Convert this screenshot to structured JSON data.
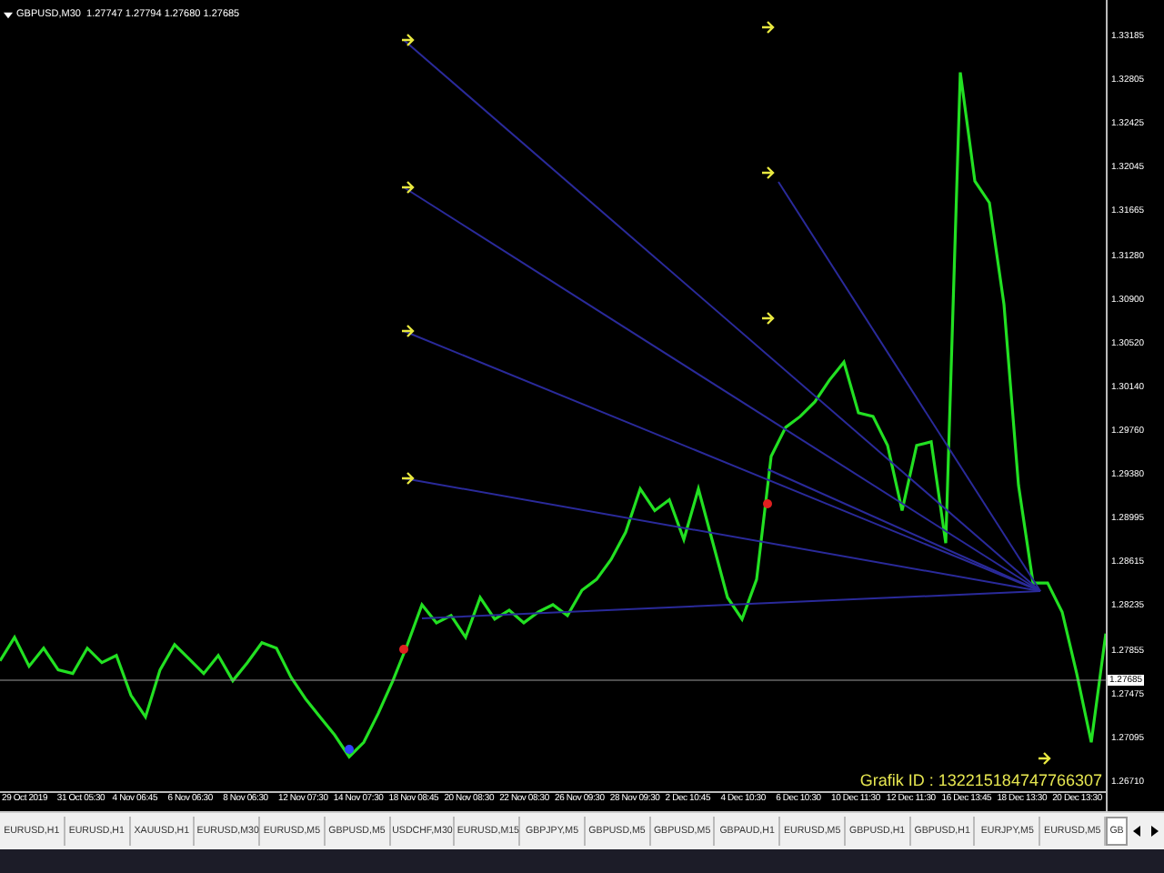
{
  "chart": {
    "title": "GBPUSD,M30  1.27747 1.27794 1.27680 1.27685",
    "info_label": "Grafik ID : 132215184747766307",
    "current_price": "1.27685",
    "time_labels": [
      "29 Oct 2019",
      "31 Oct 05:30",
      "4 Nov 06:45",
      "6 Nov 06:30",
      "8 Nov 06:30",
      "12 Nov 07:30",
      "14 Nov 07:30",
      "18 Nov 08:45",
      "20 Nov 08:30",
      "22 Nov 08:30",
      "26 Nov 09:30",
      "28 Nov 09:30",
      "2 Dec 10:45",
      "4 Dec 10:30",
      "6 Dec 10:30",
      "10 Dec 11:30",
      "12 Dec 11:30",
      "16 Dec 13:45",
      "18 Dec 13:30",
      "20 Dec 13:30"
    ],
    "chart_data": {
      "type": "line",
      "ylim": [
        1.266,
        1.335
      ],
      "yticks": [
        {
          "value": 1.33185,
          "label": "1.33185"
        },
        {
          "value": 1.32805,
          "label": "1.32805"
        },
        {
          "value": 1.32425,
          "label": "1.32425"
        },
        {
          "value": 1.32045,
          "label": "1.32045"
        },
        {
          "value": 1.31665,
          "label": "1.31665"
        },
        {
          "value": 1.3128,
          "label": "1.31280"
        },
        {
          "value": 1.309,
          "label": "1.30900"
        },
        {
          "value": 1.3052,
          "label": "1.30520"
        },
        {
          "value": 1.3014,
          "label": "1.30140"
        },
        {
          "value": 1.2976,
          "label": "1.29760"
        },
        {
          "value": 1.2938,
          "label": "1.29380"
        },
        {
          "value": 1.28995,
          "label": "1.28995"
        },
        {
          "value": 1.28615,
          "label": "1.28615"
        },
        {
          "value": 1.28235,
          "label": "1.28235"
        },
        {
          "value": 1.27855,
          "label": "1.27855"
        },
        {
          "value": 1.27475,
          "label": "1.27475"
        },
        {
          "value": 1.27095,
          "label": "1.27095"
        },
        {
          "value": 1.2671,
          "label": "1.26710"
        }
      ],
      "series": [
        {
          "color": "#22e022",
          "values": [
            1.27737,
            1.27942,
            1.2769,
            1.27848,
            1.27658,
            1.27626,
            1.27848,
            1.27721,
            1.27784,
            1.27437,
            1.27248,
            1.27658,
            1.27879,
            1.27753,
            1.27626,
            1.27784,
            1.27563,
            1.27721,
            1.27895,
            1.27848,
            1.27595,
            1.27405,
            1.27248,
            1.2709,
            1.269,
            1.27027,
            1.27279,
            1.27563,
            1.27879,
            1.28226,
            1.28069,
            1.28132,
            1.27942,
            1.2829,
            1.281,
            1.28179,
            1.28069,
            1.28163,
            1.28226,
            1.28132,
            1.28353,
            1.28448,
            1.28621,
            1.28858,
            1.29237,
            1.29048,
            1.29142,
            1.28795,
            1.29237,
            1.28763,
            1.2829,
            1.281,
            1.28448,
            1.29521,
            1.29774,
            1.29869,
            1.29995,
            1.30184,
            1.30342,
            1.299,
            1.29869,
            1.29616,
            1.29048,
            1.29616,
            1.29647,
            1.28763,
            1.32868,
            1.31921,
            1.31732,
            1.30847,
            1.29269,
            1.28416,
            1.28416,
            1.28163,
            1.27626,
            1.27027,
            1.27974
          ]
        }
      ]
    }
  },
  "tabs": [
    {
      "label": "EURUSD,H1",
      "selected": false
    },
    {
      "label": "EURUSD,H1",
      "selected": false
    },
    {
      "label": "XAUUSD,H1",
      "selected": false
    },
    {
      "label": "EURUSD,M30",
      "selected": false
    },
    {
      "label": "EURUSD,M5",
      "selected": false
    },
    {
      "label": "GBPUSD,M5",
      "selected": false
    },
    {
      "label": "USDCHF,M30",
      "selected": false
    },
    {
      "label": "EURUSD,M15",
      "selected": false
    },
    {
      "label": "GBPJPY,M5",
      "selected": false
    },
    {
      "label": "GBPUSD,M5",
      "selected": false
    },
    {
      "label": "GBPUSD,M5",
      "selected": false
    },
    {
      "label": "GBPAUD,H1",
      "selected": false
    },
    {
      "label": "EURUSD,M5",
      "selected": false
    },
    {
      "label": "GBPUSD,H1",
      "selected": false
    },
    {
      "label": "GBPUSD,H1",
      "selected": false
    },
    {
      "label": "EURJPY,M5",
      "selected": false
    },
    {
      "label": "EURUSD,M5",
      "selected": false
    },
    {
      "label": "GB",
      "selected": true
    }
  ]
}
